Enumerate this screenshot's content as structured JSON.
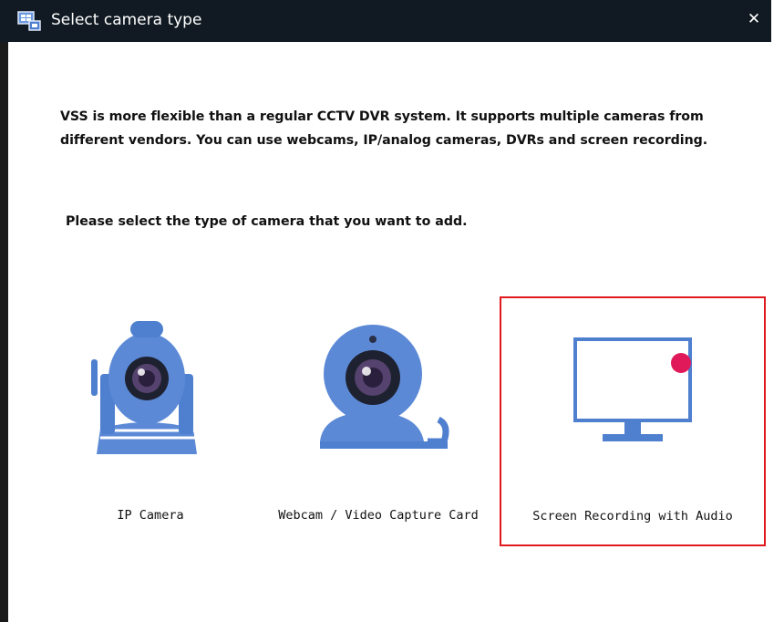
{
  "window": {
    "title": "Select camera type",
    "close_glyph": "✕"
  },
  "content": {
    "intro_line1": "VSS is more flexible than a regular CCTV DVR system. It supports multiple cameras from",
    "intro_line2": "different vendors. You can use webcams, IP/analog cameras, DVRs and screen recording.",
    "prompt": "Please select the type of camera that you want to add."
  },
  "options": [
    {
      "label": "IP Camera",
      "icon": "ip-camera-icon",
      "selected": false
    },
    {
      "label": "Webcam / Video Capture Card",
      "icon": "webcam-icon",
      "selected": false
    },
    {
      "label": "Screen Recording with Audio",
      "icon": "monitor-icon",
      "selected": true
    }
  ],
  "colors": {
    "titlebar": "#111a22",
    "icon_blue": "#4f7fcf",
    "selection_border": "#e0191f",
    "record_dot": "#e0195a"
  }
}
